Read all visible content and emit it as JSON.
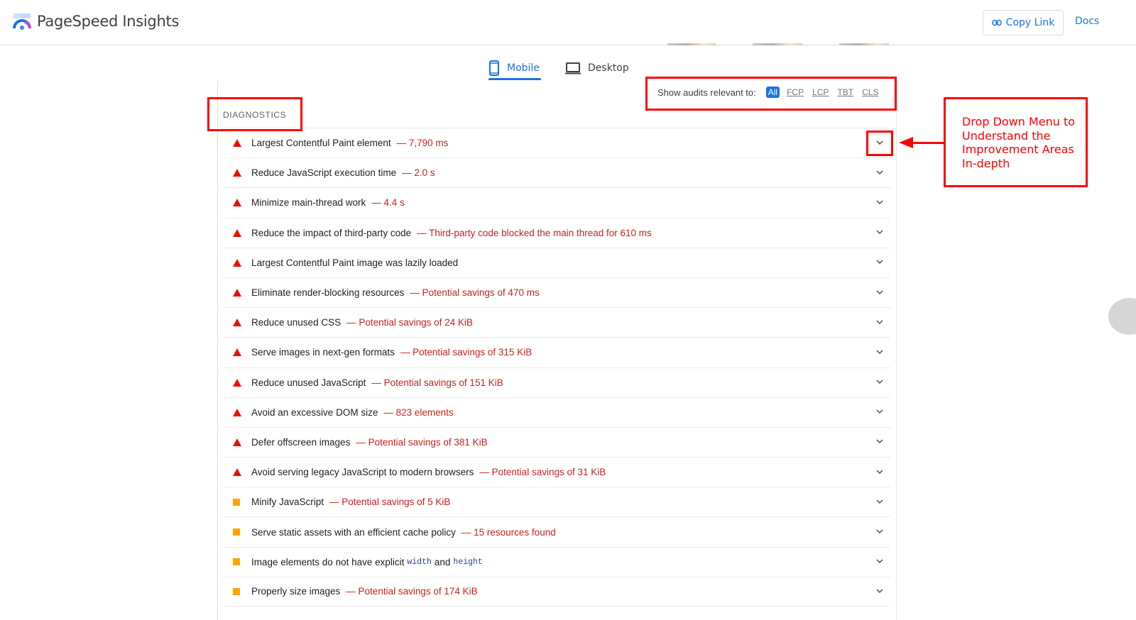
{
  "header": {
    "brand": "PageSpeed Insights",
    "copy_link_label": "Copy Link",
    "docs_label": "Docs"
  },
  "tabs": [
    {
      "label": "Mobile",
      "icon": "phone-icon",
      "active": true
    },
    {
      "label": "Desktop",
      "icon": "laptop-icon",
      "active": false
    }
  ],
  "filter": {
    "label": "Show audits relevant to:",
    "options": [
      {
        "label": "All",
        "active": true
      },
      {
        "label": "FCP",
        "active": false
      },
      {
        "label": "LCP",
        "active": false
      },
      {
        "label": "TBT",
        "active": false
      },
      {
        "label": "CLS",
        "active": false
      }
    ]
  },
  "diagnostics": {
    "title": "DIAGNOSTICS",
    "audits": [
      {
        "severity": "fail",
        "title": "Largest Contentful Paint element",
        "detail": "— 7,790 ms"
      },
      {
        "severity": "fail",
        "title": "Reduce JavaScript execution time",
        "detail": "— 2.0 s"
      },
      {
        "severity": "fail",
        "title": "Minimize main-thread work",
        "detail": "— 4.4 s"
      },
      {
        "severity": "fail",
        "title": "Reduce the impact of third-party code",
        "detail": "— Third-party code blocked the main thread for 610 ms"
      },
      {
        "severity": "fail",
        "title": "Largest Contentful Paint image was lazily loaded",
        "detail": ""
      },
      {
        "severity": "fail",
        "title": "Eliminate render-blocking resources",
        "detail": "— Potential savings of 470 ms"
      },
      {
        "severity": "fail",
        "title": "Reduce unused CSS",
        "detail": "— Potential savings of 24 KiB"
      },
      {
        "severity": "fail",
        "title": "Serve images in next-gen formats",
        "detail": "— Potential savings of 315 KiB"
      },
      {
        "severity": "fail",
        "title": "Reduce unused JavaScript",
        "detail": "— Potential savings of 151 KiB"
      },
      {
        "severity": "fail",
        "title": "Avoid an excessive DOM size",
        "detail": "— 823 elements"
      },
      {
        "severity": "fail",
        "title": "Defer offscreen images",
        "detail": "— Potential savings of 381 KiB"
      },
      {
        "severity": "fail",
        "title": "Avoid serving legacy JavaScript to modern browsers",
        "detail": "— Potential savings of 31 KiB"
      },
      {
        "severity": "average",
        "title": "Minify JavaScript",
        "detail": "— Potential savings of 5 KiB"
      },
      {
        "severity": "average",
        "title": "Serve static assets with an efficient cache policy",
        "detail": "— 15 resources found"
      },
      {
        "severity": "average",
        "title": "Image elements do not have explicit",
        "code1": "width",
        "joiner": "and",
        "code2": "height",
        "detail": ""
      },
      {
        "severity": "average",
        "title": "Properly size images",
        "detail": "— Potential savings of 174 KiB"
      }
    ]
  },
  "annotation": {
    "text": "Drop Down Menu to Understand the Improvement Areas In-depth",
    "color": "#ff0000"
  },
  "colors": {
    "accent": "#1a73e8",
    "fail": "#eb0f00",
    "average": "#ffa400",
    "detail_text": "#c7221f"
  }
}
